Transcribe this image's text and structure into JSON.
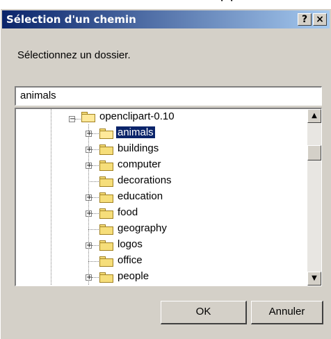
{
  "background": {
    "caption": "sur votre ordinateur) apparaît :"
  },
  "dialog": {
    "title": "Sélection d'un chemin",
    "help_label": "?",
    "close_label": "×",
    "prompt": "Sélectionnez un dossier.",
    "path_value": "animals"
  },
  "tree": {
    "root": {
      "label": "openclipart-0.10",
      "expanded": true
    },
    "items": [
      {
        "label": "animals",
        "expander": "+",
        "selected": true,
        "open": true
      },
      {
        "label": "buildings",
        "expander": "+"
      },
      {
        "label": "computer",
        "expander": "+"
      },
      {
        "label": "decorations",
        "expander": ""
      },
      {
        "label": "education",
        "expander": "+"
      },
      {
        "label": "food",
        "expander": "+"
      },
      {
        "label": "geography",
        "expander": ""
      },
      {
        "label": "logos",
        "expander": "+"
      },
      {
        "label": "office",
        "expander": ""
      },
      {
        "label": "people",
        "expander": "+"
      }
    ],
    "root_expander": "−"
  },
  "buttons": {
    "ok": "OK",
    "cancel": "Annuler"
  },
  "scrollbar": {
    "up": "▲",
    "down": "▼"
  }
}
